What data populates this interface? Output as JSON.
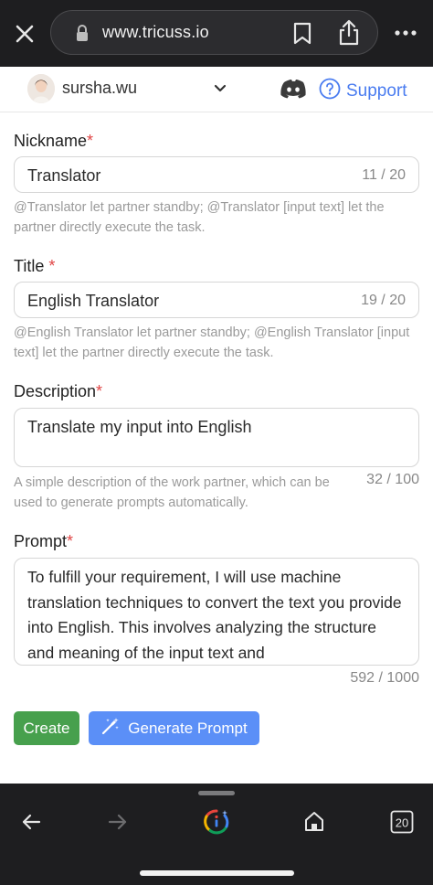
{
  "browser": {
    "url": "www.tricuss.io",
    "tab_count": "20"
  },
  "account": {
    "username": "sursha.wu",
    "support_label": "Support"
  },
  "form": {
    "nickname": {
      "label": "Nickname",
      "required_mark": "*",
      "value": "Translator",
      "counter": "11 / 20",
      "helper_line1": "@Translator let partner standby; @Translator [input text] let the",
      "helper_line2": "partner directly execute the task."
    },
    "title": {
      "label": "Title",
      "required_mark": "*",
      "value": "English Translator",
      "counter": "19 / 20",
      "helper_line1": "@English Translator let partner standby; @English Translator [input",
      "helper_line2": "text] let the partner directly execute the task."
    },
    "description": {
      "label": "Description",
      "required_mark": "*",
      "value": "Translate my input into English",
      "counter": "32 / 100",
      "helper_line1": "A simple description of the work partner, which can be",
      "helper_line2": "used to generate prompts automatically."
    },
    "prompt": {
      "label": "Prompt",
      "required_mark": "*",
      "value": "To fulfill your requirement, I will use machine translation techniques to convert the text you provide into English. This involves analyzing the structure and meaning of the input text and",
      "counter": "592 / 1000"
    }
  },
  "actions": {
    "create_label": "Create",
    "generate_label": "Generate Prompt"
  },
  "colors": {
    "create_bg": "#47a04d",
    "generate_bg": "#5b8ff7",
    "required": "#e04545",
    "link": "#4a7cf0"
  }
}
